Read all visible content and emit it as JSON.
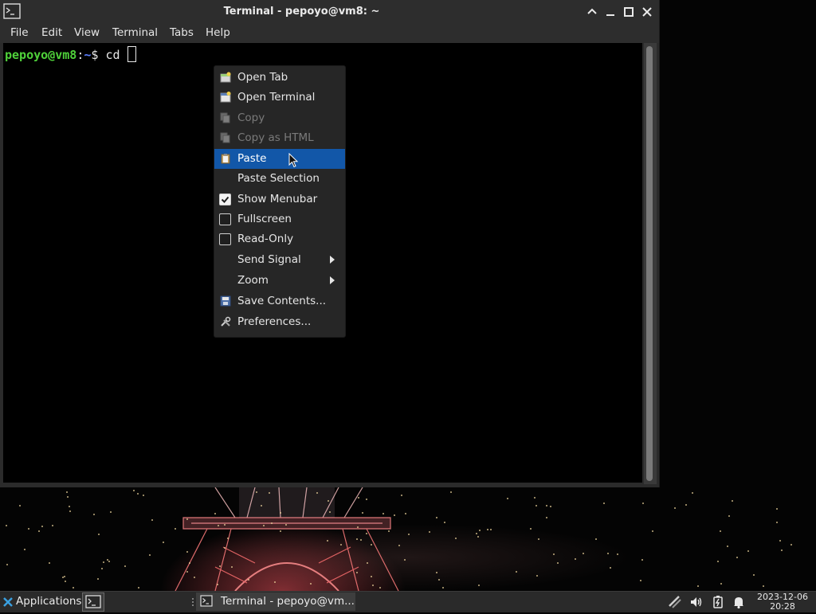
{
  "window": {
    "title": "Terminal - pepoyo@vm8: ~"
  },
  "menubar": {
    "items": [
      "File",
      "Edit",
      "View",
      "Terminal",
      "Tabs",
      "Help"
    ]
  },
  "terminal": {
    "user_host": "pepoyo@vm8",
    "colon": ":",
    "path": "~",
    "dollar": "$",
    "command": "cd"
  },
  "context_menu": {
    "items": [
      {
        "label": "Open Tab",
        "icon": "new-tab-icon",
        "state": "enabled"
      },
      {
        "label": "Open Terminal",
        "icon": "new-window-icon",
        "state": "enabled"
      },
      {
        "label": "Copy",
        "icon": "copy-icon",
        "state": "disabled"
      },
      {
        "label": "Copy as HTML",
        "icon": "copy-icon",
        "state": "disabled"
      },
      {
        "label": "Paste",
        "icon": "paste-icon",
        "state": "highlighted"
      },
      {
        "label": "Paste Selection",
        "icon": "",
        "state": "enabled"
      },
      {
        "label": "Show Menubar",
        "icon": "checkbox",
        "checked": true
      },
      {
        "label": "Fullscreen",
        "icon": "checkbox",
        "checked": false
      },
      {
        "label": "Read-Only",
        "icon": "checkbox",
        "checked": false
      },
      {
        "label": "Send Signal",
        "icon": "",
        "submenu": true
      },
      {
        "label": "Zoom",
        "icon": "",
        "submenu": true
      },
      {
        "label": "Save Contents...",
        "icon": "save-icon",
        "state": "enabled"
      },
      {
        "label": "Preferences...",
        "icon": "preferences-icon",
        "state": "enabled"
      }
    ]
  },
  "taskbar": {
    "applications_label": "Applications",
    "task_label": "Terminal - pepoyo@vm...",
    "clock_date": "2023-12-06",
    "clock_time": "20:28"
  },
  "colors": {
    "highlight": "#1257a8",
    "prompt_user": "#4fd13a",
    "prompt_path": "#5c7fff"
  }
}
